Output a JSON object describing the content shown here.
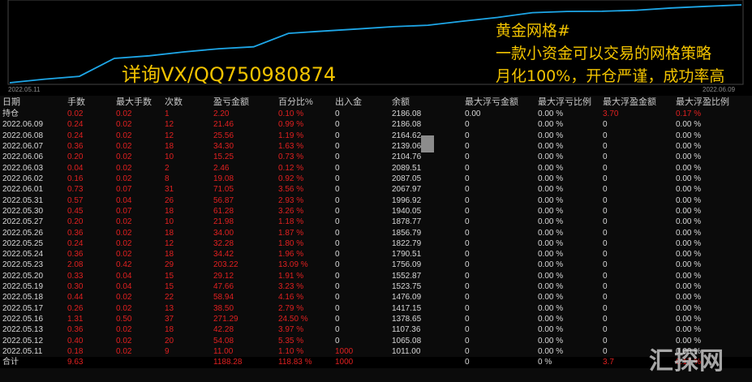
{
  "chart": {
    "start_date": "2022.05.11",
    "end_date": "2022.06.09",
    "line_color": "#1ea7e8",
    "balance_series": [
      1011.0,
      1065.08,
      1107.36,
      1378.65,
      1417.15,
      1476.09,
      1523.75,
      1552.87,
      1756.09,
      1790.51,
      1822.79,
      1856.79,
      1878.77,
      1940.05,
      1996.92,
      2067.97,
      2087.05,
      2089.51,
      2104.76,
      2139.06,
      2164.62,
      2186.08
    ]
  },
  "overlay": {
    "left_text": "详询VX/QQ750980874",
    "right_lines": [
      "黄金网格#",
      "一款小资金可以交易的网格策略",
      "月化100%，开仓严谨，成功率高"
    ]
  },
  "watermark": "汇探网",
  "colors": {
    "red": "#e12020",
    "white": "#d8d8d8",
    "accent_yellow": "#f2c300"
  },
  "table": {
    "headers": [
      "日期",
      "手数",
      "最大手数",
      "次数",
      "盈亏金额",
      "百分比%",
      "出入金",
      "余额",
      "最大浮亏金额",
      "最大浮亏比例",
      "最大浮盈金额",
      "最大浮盈比例"
    ],
    "rows": [
      [
        "持仓",
        "0.02",
        "0.02",
        "1",
        "2.20",
        "0.10 %",
        "0",
        "2186.08",
        "0.00",
        "0.00 %",
        "3.70",
        "0.17 %"
      ],
      [
        "2022.06.09",
        "0.24",
        "0.02",
        "12",
        "21.46",
        "0.99 %",
        "0",
        "2186.08",
        "0",
        "0.00 %",
        "0",
        "0.00 %"
      ],
      [
        "2022.06.08",
        "0.24",
        "0.02",
        "12",
        "25.56",
        "1.19 %",
        "0",
        "2164.62",
        "0",
        "0.00 %",
        "0",
        "0.00 %"
      ],
      [
        "2022.06.07",
        "0.36",
        "0.02",
        "18",
        "34.30",
        "1.63 %",
        "0",
        "2139.06",
        "0",
        "0.00 %",
        "0",
        "0.00 %"
      ],
      [
        "2022.06.06",
        "0.20",
        "0.02",
        "10",
        "15.25",
        "0.73 %",
        "0",
        "2104.76",
        "0",
        "0.00 %",
        "0",
        "0.00 %"
      ],
      [
        "2022.06.03",
        "0.04",
        "0.02",
        "2",
        "2.46",
        "0.12 %",
        "0",
        "2089.51",
        "0",
        "0.00 %",
        "0",
        "0.00 %"
      ],
      [
        "2022.06.02",
        "0.16",
        "0.02",
        "8",
        "19.08",
        "0.92 %",
        "0",
        "2087.05",
        "0",
        "0.00 %",
        "0",
        "0.00 %"
      ],
      [
        "2022.06.01",
        "0.73",
        "0.07",
        "31",
        "71.05",
        "3.56 %",
        "0",
        "2067.97",
        "0",
        "0.00 %",
        "0",
        "0.00 %"
      ],
      [
        "2022.05.31",
        "0.57",
        "0.04",
        "26",
        "56.87",
        "2.93 %",
        "0",
        "1996.92",
        "0",
        "0.00 %",
        "0",
        "0.00 %"
      ],
      [
        "2022.05.30",
        "0.45",
        "0.07",
        "18",
        "61.28",
        "3.26 %",
        "0",
        "1940.05",
        "0",
        "0.00 %",
        "0",
        "0.00 %"
      ],
      [
        "2022.05.27",
        "0.20",
        "0.02",
        "10",
        "21.98",
        "1.18 %",
        "0",
        "1878.77",
        "0",
        "0.00 %",
        "0",
        "0.00 %"
      ],
      [
        "2022.05.26",
        "0.36",
        "0.02",
        "18",
        "34.00",
        "1.87 %",
        "0",
        "1856.79",
        "0",
        "0.00 %",
        "0",
        "0.00 %"
      ],
      [
        "2022.05.25",
        "0.24",
        "0.02",
        "12",
        "32.28",
        "1.80 %",
        "0",
        "1822.79",
        "0",
        "0.00 %",
        "0",
        "0.00 %"
      ],
      [
        "2022.05.24",
        "0.36",
        "0.02",
        "18",
        "34.42",
        "1.96 %",
        "0",
        "1790.51",
        "0",
        "0.00 %",
        "0",
        "0.00 %"
      ],
      [
        "2022.05.23",
        "2.08",
        "0.42",
        "29",
        "203.22",
        "13.09 %",
        "0",
        "1756.09",
        "0",
        "0.00 %",
        "0",
        "0.00 %"
      ],
      [
        "2022.05.20",
        "0.33",
        "0.04",
        "15",
        "29.12",
        "1.91 %",
        "0",
        "1552.87",
        "0",
        "0.00 %",
        "0",
        "0.00 %"
      ],
      [
        "2022.05.19",
        "0.30",
        "0.04",
        "15",
        "47.66",
        "3.23 %",
        "0",
        "1523.75",
        "0",
        "0.00 %",
        "0",
        "0.00 %"
      ],
      [
        "2022.05.18",
        "0.44",
        "0.02",
        "22",
        "58.94",
        "4.16 %",
        "0",
        "1476.09",
        "0",
        "0.00 %",
        "0",
        "0.00 %"
      ],
      [
        "2022.05.17",
        "0.26",
        "0.02",
        "13",
        "38.50",
        "2.79 %",
        "0",
        "1417.15",
        "0",
        "0.00 %",
        "0",
        "0.00 %"
      ],
      [
        "2022.05.16",
        "1.31",
        "0.50",
        "37",
        "271.29",
        "24.50 %",
        "0",
        "1378.65",
        "0",
        "0.00 %",
        "0",
        "0.00 %"
      ],
      [
        "2022.05.13",
        "0.36",
        "0.02",
        "18",
        "42.28",
        "3.97 %",
        "0",
        "1107.36",
        "0",
        "0.00 %",
        "0",
        "0.00 %"
      ],
      [
        "2022.05.12",
        "0.40",
        "0.02",
        "20",
        "54.08",
        "5.35 %",
        "0",
        "1065.08",
        "0",
        "0.00 %",
        "0",
        "0.00 %"
      ],
      [
        "2022.05.11",
        "0.18",
        "0.02",
        "9",
        "11.00",
        "1.10 %",
        "1000",
        "1011.00",
        "0",
        "0.00 %",
        "0",
        "0.00 %"
      ]
    ],
    "total": [
      "合计",
      "9.63",
      "",
      "",
      "1188.28",
      "118.83 %",
      "1000",
      "",
      "0",
      "0 %",
      "3.7",
      "0.17 %"
    ]
  }
}
